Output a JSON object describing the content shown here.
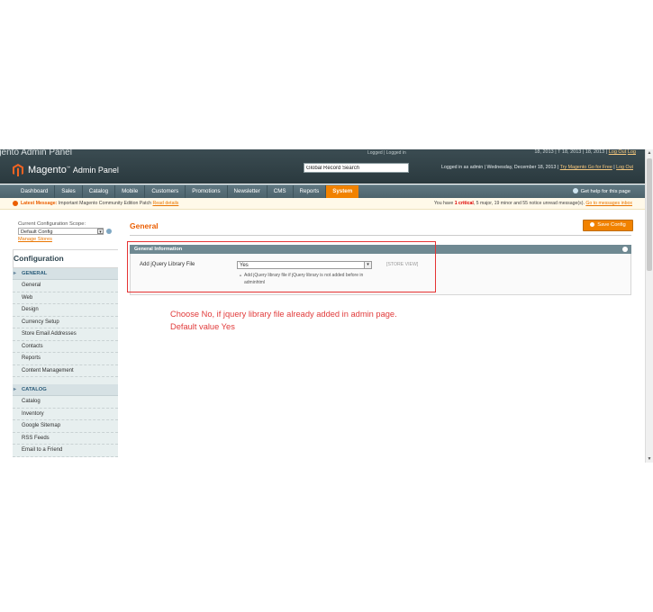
{
  "header": {
    "ghost_title": "gento Admin Panel",
    "ghost_mid": "Logged | Logged in",
    "ghost_top_right_text": "18, 2013 | T 18, 2013 | 18, 2013 |",
    "ghost_top_right_link1": "Log Out",
    "ghost_top_right_link2": "Log",
    "logo_brand": "Magento",
    "logo_suffix": "Admin Panel",
    "search_value": "Global Record Search",
    "info_text": "Logged in as admin | Wednesday, December 18, 2013 |",
    "info_link1": "Try Magento Go for Free",
    "info_sep": "|",
    "info_link2": "Log Out"
  },
  "nav": {
    "items": [
      "Dashboard",
      "Sales",
      "Catalog",
      "Mobile",
      "Customers",
      "Promotions",
      "Newsletter",
      "CMS",
      "Reports",
      "System"
    ],
    "active_index": 9,
    "help": "Get help for this page"
  },
  "messages": {
    "latest_label": "Latest Message:",
    "latest_text": "Important Magento Community Edition Patch",
    "latest_link": "Read details",
    "right_prefix": "You have",
    "critical_count": "1 critical",
    "right_mid": ", 5 major, 19 minor and 55 notice unread message(s).",
    "right_link": "Go to messages inbox"
  },
  "sidebar": {
    "scope_label": "Current Configuration Scope:",
    "scope_value": "Default Config",
    "manage_stores": "Manage Stores",
    "config_title": "Configuration",
    "sections": [
      {
        "title": "GENERAL",
        "items": [
          "General",
          "Web",
          "Design",
          "Currency Setup",
          "Store Email Addresses",
          "Contacts",
          "Reports",
          "Content Management"
        ]
      },
      {
        "title": "CATALOG",
        "items": [
          "Catalog",
          "Inventory",
          "Google Sitemap",
          "RSS Feeds",
          "Email to a Friend"
        ]
      }
    ]
  },
  "main": {
    "page_title": "General",
    "save_button": "Save Config",
    "fieldset_title": "General Information",
    "field_label": "Add jQuery Library File",
    "field_value": "Yes",
    "field_note": "Add jQuery library file if jQuery library is not added before in adminhtml",
    "field_scope": "[STORE VIEW]"
  },
  "annotation": {
    "line1": "Choose No, if jquery library file already added in admin page.",
    "line2": "Default value Yes"
  },
  "colors": {
    "accent_orange": "#f18200",
    "header_dark": "#2a393e",
    "annotation_red": "#e13b3b"
  }
}
